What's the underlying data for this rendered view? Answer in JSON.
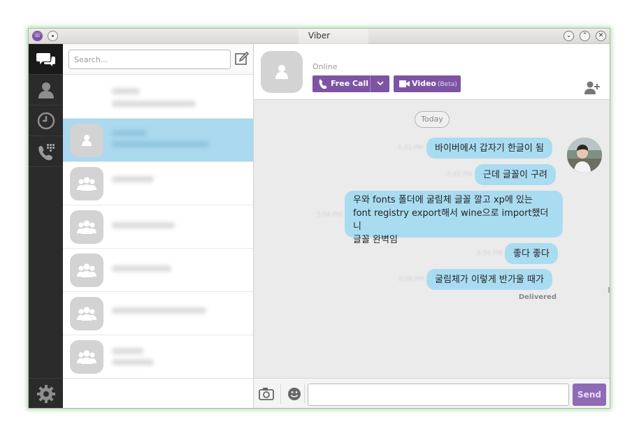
{
  "window": {
    "title": "Viber"
  },
  "rail": {
    "items": [
      {
        "icon": "chat-bubbles-icon",
        "active": true
      },
      {
        "icon": "contacts-icon",
        "active": false
      },
      {
        "icon": "recents-clock-icon",
        "active": false
      },
      {
        "icon": "dialpad-phone-icon",
        "active": false
      }
    ],
    "settings_icon": "gear-icon"
  },
  "contacts": {
    "search_placeholder": "Search...",
    "compose_icon": "compose-icon"
  },
  "chat": {
    "status": "Online",
    "free_call_label": "Free Call",
    "video_label": "Video",
    "video_beta_label": "(Beta)",
    "date_separator": "Today",
    "messages": [
      {
        "text": "바이버에서 갑자기 한글이 됨"
      },
      {
        "text": "근데 글꼴이 구려"
      },
      {
        "lines": [
          "우와 fonts 폴더에 굴림체 글꼴 깔고 xp에 있는",
          "font registry export해서 wine으로 import했더니",
          "글꼴 완벽임"
        ]
      },
      {
        "text": "좋다 좋다"
      },
      {
        "text": "굴림체가 이렇게 반가울 때가"
      }
    ],
    "delivered": "Delivered",
    "send_label": "Send"
  },
  "colors": {
    "accent_purple": "#7d54a4",
    "bubble_blue": "#aadcf1",
    "selected_row": "#abd9ef",
    "rail_dark": "#2b2b2b"
  }
}
